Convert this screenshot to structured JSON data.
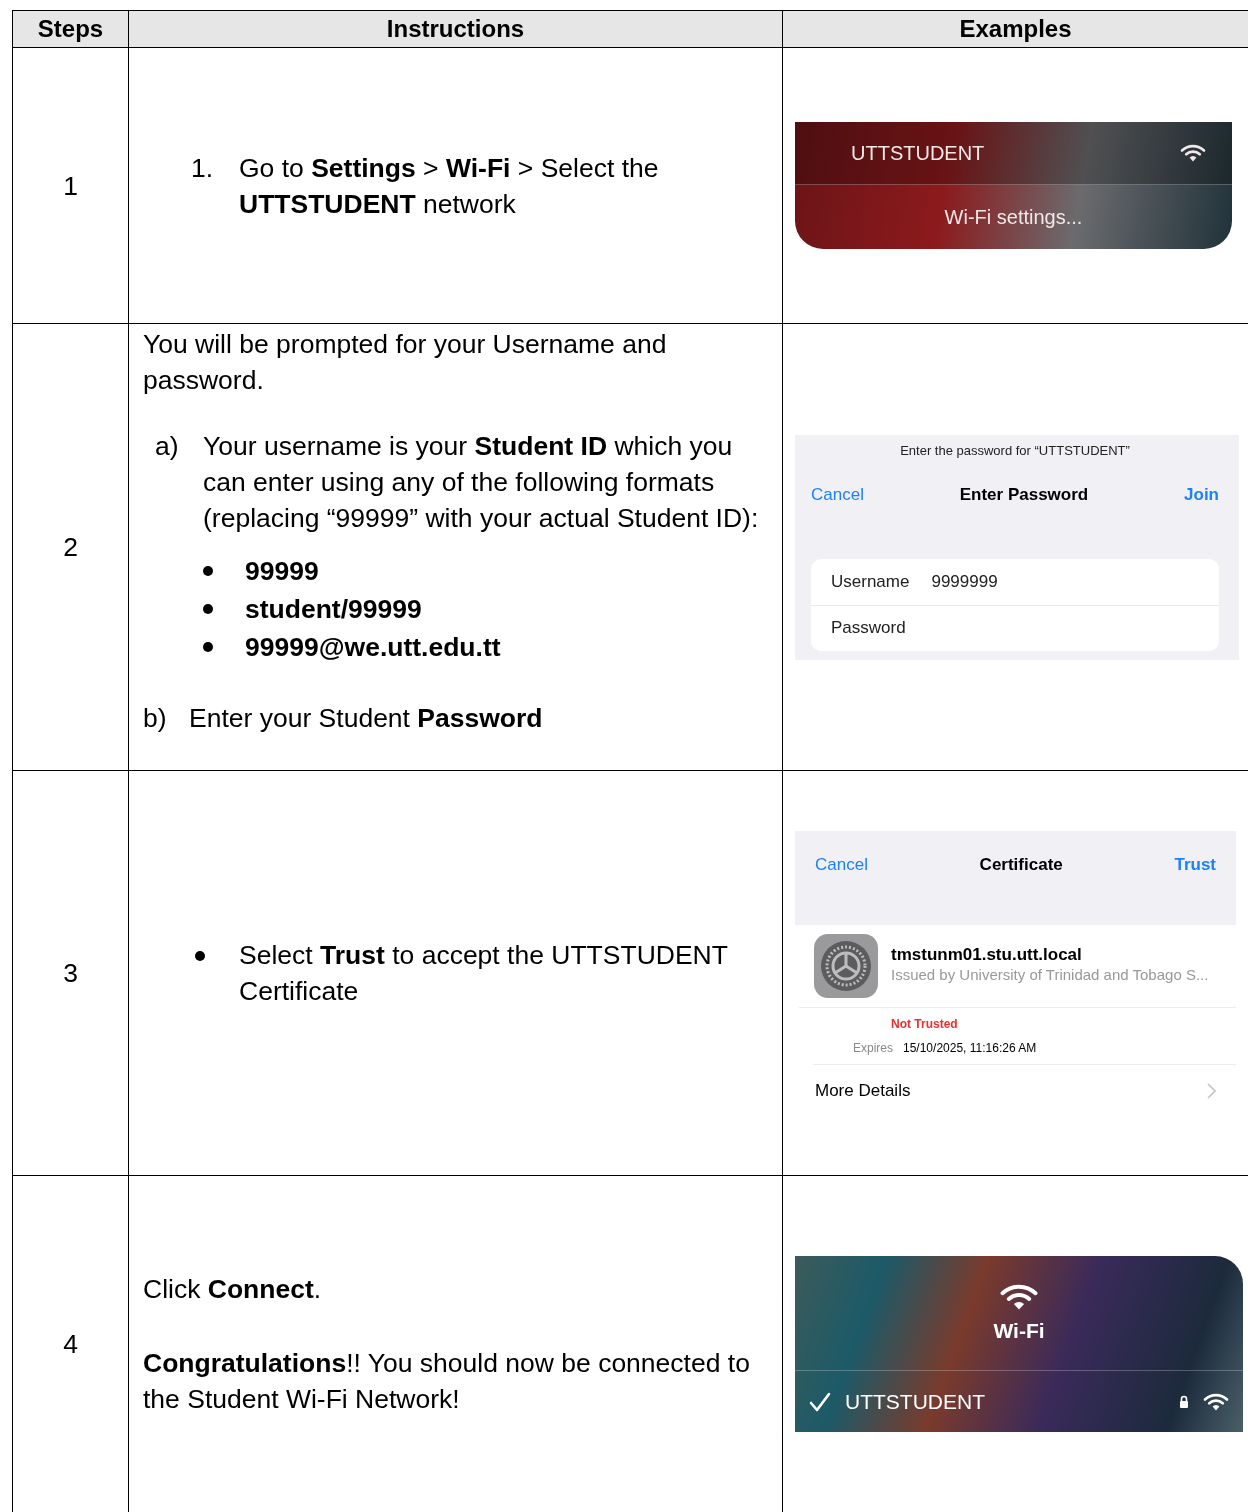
{
  "table": {
    "columns": [
      "Steps",
      "Instructions",
      "Examples"
    ],
    "rows": [
      {
        "step": "1",
        "instructions": [
          {
            "kind": "numbered",
            "marker": "1.",
            "text": "Go to **Settings** > **Wi-Fi** > Select the **UTTSTUDENT** network"
          }
        ],
        "example": {
          "kind": "network_popup",
          "network": "UTTSTUDENT",
          "action": "Wi-Fi settings..."
        }
      },
      {
        "step": "2",
        "instructions": [
          {
            "kind": "paragraph",
            "text": "You will be prompted for your Username and password."
          },
          {
            "kind": "lettered",
            "marker": "a)",
            "text": "Your username is your **Student ID** which you can enter using any of the following formats (replacing “99999” with your actual Student ID):"
          },
          {
            "kind": "format",
            "text": "99999"
          },
          {
            "kind": "format",
            "text": "student/99999"
          },
          {
            "kind": "format",
            "text": "99999@we.utt.edu.tt"
          },
          {
            "kind": "outdent",
            "marker": "b)",
            "text": "Enter your Student **Password**"
          }
        ],
        "example": {
          "kind": "password_sheet",
          "prompt": "Enter the password for “UTTSTUDENT”",
          "cancel": "Cancel",
          "title": "Enter Password",
          "confirm": "Join",
          "fields": [
            {
              "label": "Username",
              "value": "9999999"
            },
            {
              "label": "Password"
            }
          ]
        }
      },
      {
        "step": "3",
        "instructions": [
          {
            "kind": "bullet",
            "text": "Select **Trust** to accept the UTTSTUDENT Certificate"
          }
        ],
        "example": {
          "kind": "certificate",
          "cancel": "Cancel",
          "title": "Certificate",
          "confirm": "Trust",
          "name": "tmstunm01.stu.utt.local",
          "issuer": "Issued by University of Trinidad and Tobago S...",
          "status": "Not Trusted",
          "expires_label": "Expires",
          "expires": "15/10/2025, 11:16:26 AM",
          "more": "More Details"
        }
      },
      {
        "step": "4",
        "instructions": [
          {
            "kind": "paragraph",
            "text": "Click **Connect**."
          },
          {
            "kind": "paragraph",
            "text": "**Congratulations**!!  You should now be connected to the Student Wi-Fi Network!"
          }
        ],
        "example": {
          "kind": "wifi_panel",
          "title": "Wi-Fi",
          "network": "UTTSTUDENT",
          "connected": true
        }
      }
    ]
  }
}
